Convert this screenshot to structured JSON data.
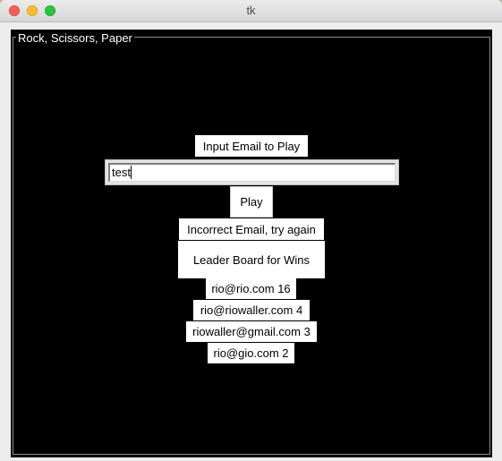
{
  "window": {
    "title": "tk"
  },
  "frame": {
    "title": "Rock, Scissors, Paper"
  },
  "prompt_label": "Input Email to Play",
  "email_input": {
    "value": "test"
  },
  "play_button": {
    "label": "Play"
  },
  "status_message": "Incorrect Email, try again",
  "leaderboard": {
    "heading": "Leader Board for Wins",
    "entries": [
      "rio@rio.com 16",
      "rio@riowaller.com 4",
      "riowaller@gmail.com 3",
      "rio@gio.com 2"
    ]
  },
  "colors": {
    "canvas_background": "#000000",
    "label_background": "#ffffff",
    "close_button": "#fe5f57",
    "minimize_button": "#febc2e",
    "zoom_button": "#28c840"
  }
}
